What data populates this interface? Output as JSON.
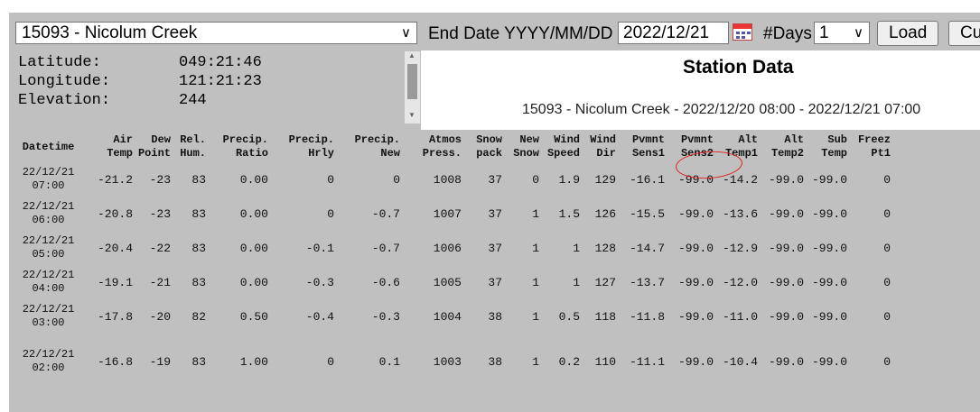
{
  "header": {
    "station_selected": "15093 - Nicolum Creek",
    "end_date_label": "End Date YYYY/MM/DD",
    "end_date_value": "2022/12/21",
    "days_label": "#Days",
    "days_value": "1",
    "load_label": "Load",
    "cut_label": "Cu"
  },
  "coords": {
    "latitude_label": "Latitude:",
    "latitude_value": "049:21:46",
    "longitude_label": "Longitude:",
    "longitude_value": "121:21:23",
    "elevation_label": "Elevation:",
    "elevation_value": "244"
  },
  "station": {
    "title": "Station Data",
    "subtitle": "15093 - Nicolum Creek - 2022/12/20 08:00 - 2022/12/21 07:00"
  },
  "table": {
    "headers": [
      [
        "Datetime"
      ],
      [
        "Air",
        "Temp"
      ],
      [
        "Dew",
        "Point"
      ],
      [
        "Rel.",
        "Hum."
      ],
      [
        "Precip.",
        "Ratio"
      ],
      [
        "Precip.",
        "Hrly"
      ],
      [
        "Precip.",
        "New"
      ],
      [
        "Atmos",
        "Press."
      ],
      [
        "Snow",
        "pack"
      ],
      [
        "New",
        "Snow"
      ],
      [
        "Wind",
        "Speed"
      ],
      [
        "Wind",
        "Dir"
      ],
      [
        "Pvmnt",
        "Sens1"
      ],
      [
        "Pvmnt",
        "Sens2"
      ],
      [
        "Alt",
        "Temp1"
      ],
      [
        "Alt",
        "Temp2"
      ],
      [
        "Sub",
        "Temp"
      ],
      [
        "Freez",
        "Pt1"
      ]
    ],
    "rows": [
      [
        "22/12/21",
        "07:00",
        "-21.2",
        "-23",
        "83",
        "0.00",
        "0",
        "0",
        "1008",
        "37",
        "0",
        "1.9",
        "129",
        "-16.1",
        "-99.0",
        "-14.2",
        "-99.0",
        "-99.0",
        "0"
      ],
      [
        "22/12/21",
        "06:00",
        "-20.8",
        "-23",
        "83",
        "0.00",
        "0",
        "-0.7",
        "1007",
        "37",
        "1",
        "1.5",
        "126",
        "-15.5",
        "-99.0",
        "-13.6",
        "-99.0",
        "-99.0",
        "0"
      ],
      [
        "22/12/21",
        "05:00",
        "-20.4",
        "-22",
        "83",
        "0.00",
        "-0.1",
        "-0.7",
        "1006",
        "37",
        "1",
        "1",
        "128",
        "-14.7",
        "-99.0",
        "-12.9",
        "-99.0",
        "-99.0",
        "0"
      ],
      [
        "22/12/21",
        "04:00",
        "-19.1",
        "-21",
        "83",
        "0.00",
        "-0.3",
        "-0.6",
        "1005",
        "37",
        "1",
        "1",
        "127",
        "-13.7",
        "-99.0",
        "-12.0",
        "-99.0",
        "-99.0",
        "0"
      ],
      [
        "22/12/21",
        "03:00",
        "-17.8",
        "-20",
        "82",
        "0.50",
        "-0.4",
        "-0.3",
        "1004",
        "38",
        "1",
        "0.5",
        "118",
        "-11.8",
        "-99.0",
        "-11.0",
        "-99.0",
        "-99.0",
        "0"
      ],
      [
        "22/12/21",
        "02:00",
        "-16.8",
        "-19",
        "83",
        "1.00",
        "0",
        "0.1",
        "1003",
        "38",
        "1",
        "0.2",
        "110",
        "-11.1",
        "-99.0",
        "-10.4",
        "-99.0",
        "-99.0",
        "0"
      ]
    ]
  },
  "annotation": {
    "highlight_color": "#e02020"
  }
}
